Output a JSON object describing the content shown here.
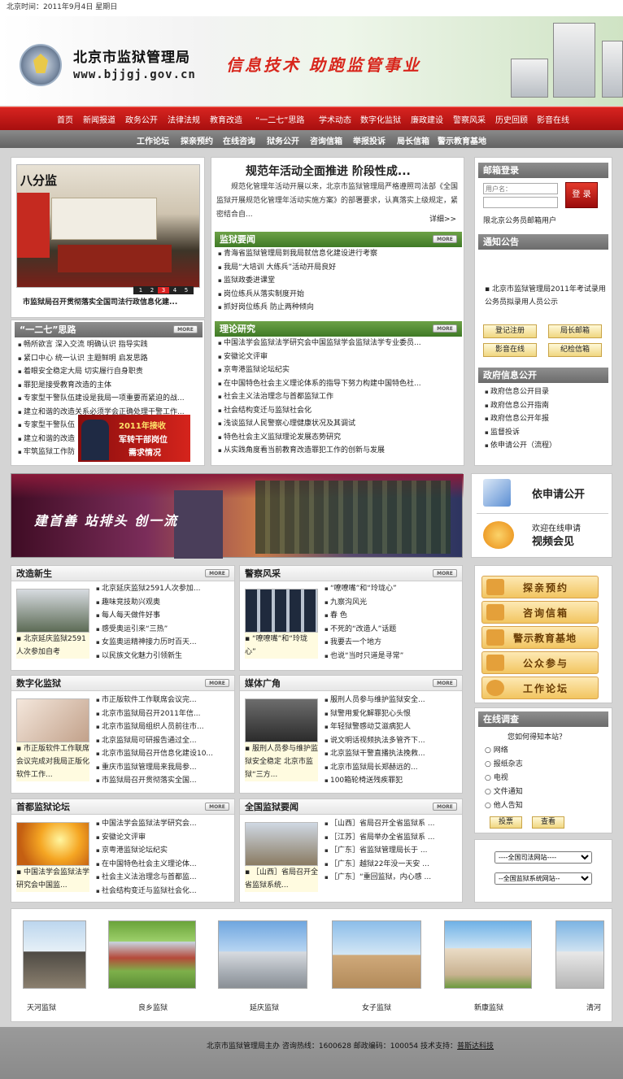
{
  "topbar": {
    "date": "北京时间：2011年9月4日  星期日"
  },
  "header": {
    "org_name": "北京市监狱管理局",
    "url": "www.bjjgj.gov.cn",
    "slogan": "信息技术  助跑监管事业"
  },
  "nav_main": [
    "首页",
    "新闻报道",
    "政务公开",
    "法律法规",
    "教育改造",
    "“一二七”思路",
    "学术动态",
    "数字化监狱",
    "廉政建设",
    "警察风采",
    "历史回顾",
    "影音在线"
  ],
  "nav_sub": [
    "工作论坛",
    "探亲预约",
    "在线咨询",
    "狱务公开",
    "咨询信箱",
    "举报投诉",
    "局长信箱",
    "警示教育基地"
  ],
  "slideshow": {
    "image_text": "八分监",
    "caption": "市监狱局召开贯彻落实全国司法行政信息化建...",
    "pages": [
      "1",
      "2",
      "3",
      "4",
      "5"
    ],
    "active": 3
  },
  "headline": {
    "title": "规范年活动全面推进  阶段性成...",
    "body": "规范化管理年活动开展以来，北京市监狱管理局严格遵照司法部《全国监狱开展规范化管理年活动实施方案》的部署要求，认真落实上级规定，紧密结合自...",
    "detail": "详细>>"
  },
  "more_label": "MORE",
  "prison_news": {
    "title": "监狱要闻",
    "items": [
      "青海省监狱管理局到我局就信息化建设进行考察",
      "我局“大培训 大练兵”活动开局良好",
      "监狱政委进课堂",
      "岗位练兵从落实制度开始",
      "抓好岗位练兵 防止两种倾向"
    ]
  },
  "theory": {
    "title": "理论研究",
    "items": [
      "中国法学会监狱法学研究会中国监狱学会监狱法学专业委员...",
      "安徽论文评审",
      "京粤港监狱论坛纪实",
      "在中国特色社会主义理论体系的指导下努力构建中国特色社...",
      "社会主义法治理念与首都监狱工作",
      "社会结构变迁与监狱社会化",
      "浅谈监狱人民警察心理健康状况及其调试",
      "特色社会主义监狱理论发展态势研究",
      "从实践角度看当前教育改造罪犯工作的创新与发展"
    ]
  },
  "thinking": {
    "title": "“一二七”思路",
    "items": [
      "畅所欲言 深入交流 明确认识 指导实践",
      "紧口中心 统一认识 主题鲜明 启发思路",
      "着眼安全稳定大局 切实履行自身职责",
      "罪犯是接受教育改造的主体",
      "专家型干警队伍建设是我局一项重要而紧迫的战...",
      "建立和谐的改造关系必须学会正确处理干警工作...",
      "专家型干警队伍",
      "建立和谐的改造",
      "牢筑监狱工作防"
    ],
    "badge_line1": "2011年接收",
    "badge_line2": "军转干部岗位",
    "badge_line3": "需求情况"
  },
  "mail_login": {
    "title": "邮箱登录",
    "user_placeholder": "用户名：",
    "login": "登 录",
    "note": "限北京公务员邮箱用户"
  },
  "notice": {
    "title": "通知公告",
    "item": "北京市监狱管理局2011年考试录用公务员拟录用人员公示"
  },
  "quick_buttons": [
    "登记注册",
    "局长邮箱",
    "影音在线",
    "纪检信箱"
  ],
  "gov_info": {
    "title": "政府信息公开",
    "items": [
      "政府信息公开目录",
      "政府信息公开指南",
      "政府信息公开年报",
      "监督投诉",
      "依申请公开（流程）"
    ]
  },
  "wide_banner": {
    "text": "建首善  站排头  创一流"
  },
  "apply_box": {
    "apply": "依申请公开",
    "welcome": "欢迎在线申请",
    "video": "视频会见"
  },
  "reform": {
    "title": "改造新生",
    "caption": "北京延庆监狱2591人次参加自考",
    "items": [
      "北京延庆监狱2591人次参加...",
      "趣味竞技助兴观奥",
      "每人每天做件好事",
      "感受奥运引来“三热”",
      "女监奥运精神接力历时百天...",
      "以民族文化魅力引领新生"
    ]
  },
  "police": {
    "title": "警察风采",
    "caption": "“嘹嘹嘴”和“玲珑心”",
    "items": [
      "“嘹嘹嘴”和“玲珑心”",
      "九察沟风光",
      "春 色",
      "不死的“改造人”话题",
      "我要去一个地方",
      "也说“当时只道是寻常”"
    ]
  },
  "digital": {
    "title": "数字化监狱",
    "caption": "市正版软件工作联席会议完成对我局正版化软件工作...",
    "items": [
      "市正版软件工作联席会议完...",
      "北京市监狱局召开2011年信...",
      "北京市监狱局组织人员前往市...",
      "北京监狱局可研报告通过全...",
      "北京市监狱局召开信息化建设10...",
      "重庆市监狱管理局来我局参...",
      "市监狱局召开贯彻落实全国..."
    ]
  },
  "media": {
    "title": "媒体广角",
    "caption": "服刑人员参与维护监狱安全稳定 北京市监狱“三方...",
    "items": [
      "服刑人员参与维护监狱安全...",
      "狱警用爱化解罪犯心头恨",
      "年轻狱警感动艾滋病犯人",
      "说文明话视频执法多管齐下...",
      "北京监狱干警直播执法挽救...",
      "北京市监狱局长郑赫远的...",
      "100箱轮椅送残疾罪犯"
    ]
  },
  "forum": {
    "title": "首都监狱论坛",
    "caption": "中国法学会监狱法学研究会中国监...",
    "items": [
      "中国法学会监狱法学研究会...",
      "安徽论文评审",
      "京粤港监狱论坛纪实",
      "在中国特色社会主义理论体...",
      "社会主义法治理念与首都监...",
      "社会结构变迁与监狱社会化..."
    ]
  },
  "national": {
    "title": "全国监狱要闻",
    "caption": "［山西］省局召开全省监狱系统...",
    "items": [
      "［山西］省局召开全省监狱系 ...",
      "［江苏］省局举办全省监狱系 ...",
      "［广东］省监狱管理局长于 ...",
      "［广东］越狱22年没一天安 ...",
      "［广东］“重回监狱，内心感 ..."
    ]
  },
  "side_services": [
    "探亲预约",
    "咨询信箱",
    "警示教育基地",
    "公众参与",
    "工作论坛"
  ],
  "survey": {
    "title": "在线调查",
    "question": "您如何得知本站？",
    "options": [
      "网络",
      "报纸杂志",
      "电视",
      "文件通知",
      "他人告知"
    ],
    "vote": "投票",
    "view": "查看"
  },
  "selects": [
    "----全国司法网站----",
    "--全国监狱系统网站--"
  ],
  "photos": [
    "天河监狱",
    "良乡监狱",
    "延庆监狱",
    "女子监狱",
    "新康监狱",
    "清河"
  ],
  "footer": {
    "text": "北京市监狱管理局主办  咨询热线：1600628  邮政编码：100054    技术支持：",
    "support": "普斯达科技"
  }
}
